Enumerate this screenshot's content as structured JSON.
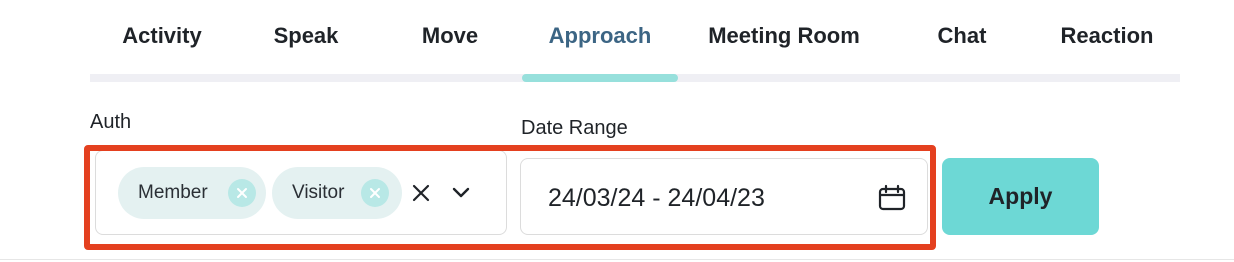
{
  "tabs": [
    {
      "label": "Activity",
      "active": false
    },
    {
      "label": "Speak",
      "active": false
    },
    {
      "label": "Move",
      "active": false
    },
    {
      "label": "Approach",
      "active": true
    },
    {
      "label": "Meeting Room",
      "active": false
    },
    {
      "label": "Chat",
      "active": false
    },
    {
      "label": "Reaction",
      "active": false
    }
  ],
  "filters": {
    "auth": {
      "label": "Auth",
      "selected": [
        "Member",
        "Visitor"
      ],
      "clear_icon": "close-icon",
      "dropdown_icon": "chevron-down-icon"
    },
    "date_range": {
      "label": "Date Range",
      "value": "24/03/24 - 24/04/23",
      "icon": "calendar-icon"
    },
    "apply_label": "Apply"
  },
  "colors": {
    "accent": "#6dd8d5",
    "active_tab_text": "#3c6584",
    "tab_indicator": "#97e0dc",
    "chip_bg": "#e4f1f1",
    "highlight": "#e4401f"
  }
}
